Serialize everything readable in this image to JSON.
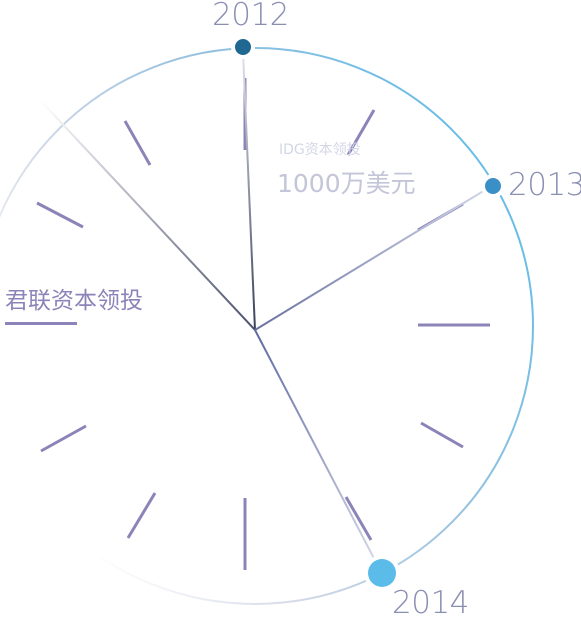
{
  "timeline": {
    "years": [
      "2012",
      "2013",
      "2014"
    ]
  },
  "annotations": {
    "idg_label": "IDG资本领投",
    "idg_amount": "1000万美元",
    "junlian_label": "君联资本领投"
  },
  "colors": {
    "tick": "#8c84b8",
    "dot_2012": "#1f6891",
    "dot_2013": "#3b8fc7",
    "dot_2014": "#5bbbe9",
    "ring_start": "#5bbbe9",
    "ring_end": "#e8eaf2"
  }
}
